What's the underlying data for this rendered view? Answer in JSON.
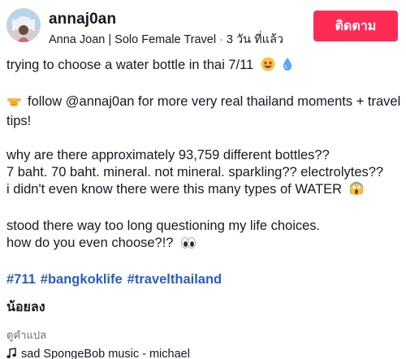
{
  "author": {
    "username": "annaj0an",
    "display_name": "Anna Joan | Solo Female Travel",
    "separator": "·",
    "posted_time": "3 วัน ที่แล้ว",
    "follow_label": "ติดตาม"
  },
  "caption": {
    "title": "trying to choose a water bottle in thai 7/11",
    "follow_line": "follow @annaj0an for more very real thailand moments + travel tips!",
    "para2_line1": "why are there approximately 93,759 different bottles??",
    "para2_line2": "7 baht. 70 baht. mineral. not mineral. sparkling?? electrolytes??",
    "para2_line3": "i didn't even know there were this many types of WATER",
    "para3_line1": "stood there way too long questioning my life choices.",
    "para3_line2": "how do you even choose?!?",
    "hashtags": [
      "#711",
      "#bangkoklife",
      "#travelthailand"
    ]
  },
  "see_less_label": "น้อยลง",
  "translate_label": "ดูคำแปล",
  "music": {
    "icon": "music-note-icon",
    "title": "sad SpongeBob music - michael"
  },
  "colors": {
    "follow_button": "#fe2c55",
    "hashtag": "#2b5db9",
    "muted_text": "#6b6b73"
  }
}
